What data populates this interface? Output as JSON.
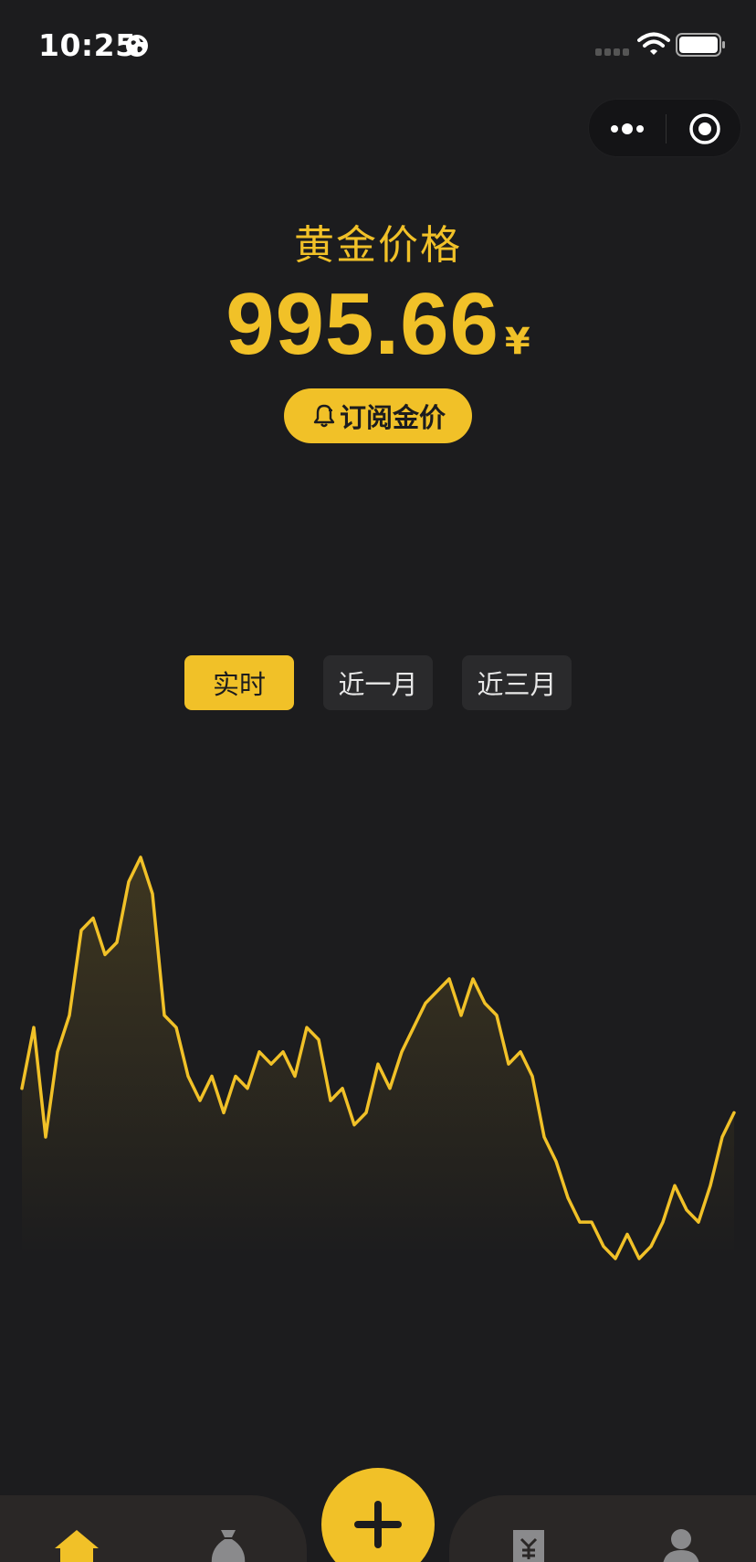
{
  "status_bar": {
    "time": "10:25"
  },
  "header": {
    "title": "黄金价格"
  },
  "price": {
    "value": "995.66",
    "currency": "¥"
  },
  "subscribe": {
    "label": "订阅金价"
  },
  "tabs": [
    {
      "label": "实时",
      "active": true
    },
    {
      "label": "近一月",
      "active": false
    },
    {
      "label": "近三月",
      "active": false
    }
  ],
  "colors": {
    "accent": "#f1c128",
    "background": "#1c1c1e",
    "tab_inactive": "#2a2a2c"
  },
  "chart_data": {
    "type": "area",
    "series": [
      {
        "values": [
          980,
          985,
          976,
          983,
          986,
          993,
          994,
          991,
          992,
          997,
          999,
          996,
          986,
          985,
          981,
          979,
          981,
          978,
          981,
          980,
          983,
          982,
          983,
          981,
          985,
          984,
          979,
          980,
          977,
          978,
          982,
          980,
          983,
          985,
          987,
          988,
          989,
          986,
          989,
          987,
          986,
          982,
          983,
          981,
          976,
          974,
          971,
          969,
          969,
          967,
          966,
          968,
          966,
          967,
          969,
          972,
          970,
          969,
          972,
          976,
          978
        ]
      }
    ],
    "grid": false,
    "legend": "none"
  },
  "nav": {
    "items": [
      {
        "icon": "home-icon",
        "active": true
      },
      {
        "icon": "money-bag-icon",
        "active": false
      },
      {
        "icon": "add-icon",
        "active": false
      },
      {
        "icon": "receipt-icon",
        "active": false
      },
      {
        "icon": "user-icon",
        "active": false
      }
    ]
  }
}
